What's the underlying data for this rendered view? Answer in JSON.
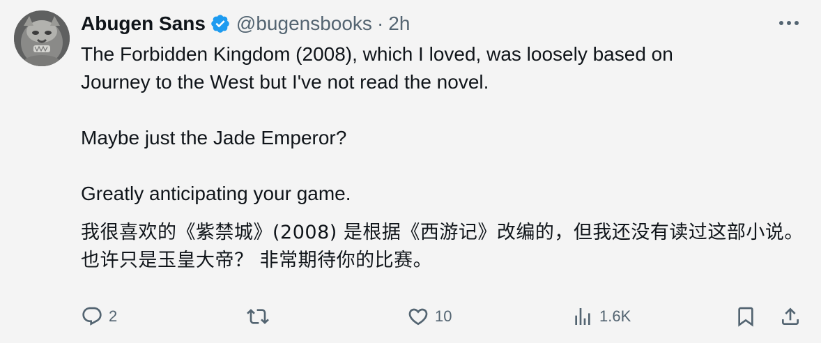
{
  "author": {
    "display_name": "Abugen Sans",
    "handle": "@bugensbooks",
    "separator": "·",
    "time": "2h",
    "verified": true,
    "verified_color": "#1d9bf0"
  },
  "tweet": {
    "paragraphs": [
      "The Forbidden Kingdom (2008), which I loved, was loosely based on\nJourney to the West but I've not read the novel.",
      "Maybe just the Jade Emperor?",
      "Greatly anticipating your game."
    ],
    "translation": "我很喜欢的《紫禁城》(2008) 是根据《西游记》改编的，但我还没有读过这部小说。 也许只是玉皇大帝？ 非常期待你的比赛。"
  },
  "actions": {
    "reply": {
      "icon": "reply-icon",
      "count": "2"
    },
    "retweet": {
      "icon": "retweet-icon",
      "count": ""
    },
    "like": {
      "icon": "heart-icon",
      "count": "10"
    },
    "views": {
      "icon": "analytics-icon",
      "count": "1.6K"
    },
    "bookmark": {
      "icon": "bookmark-icon"
    },
    "share": {
      "icon": "share-icon"
    }
  },
  "colors": {
    "background": "#f4f4f4",
    "text": "#0f1419",
    "muted": "#536471",
    "accent": "#1d9bf0"
  }
}
